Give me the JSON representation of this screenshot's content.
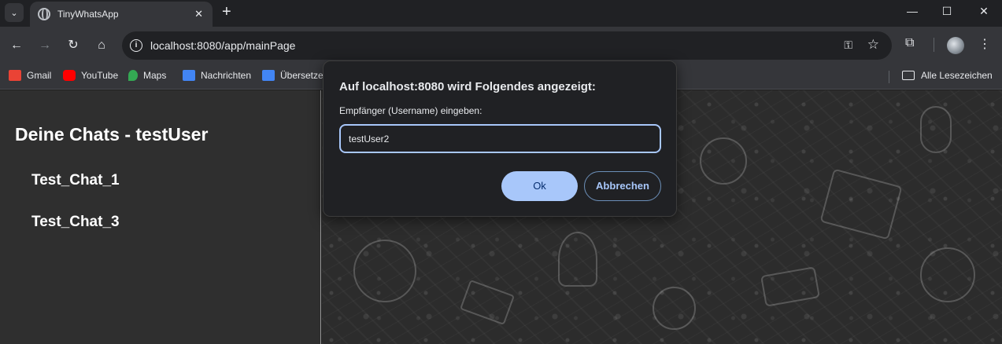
{
  "browser": {
    "tab_title": "TinyWhatsApp",
    "url": "localhost:8080/app/mainPage",
    "bookmarks": [
      {
        "label": "Gmail",
        "icon": "gmail-icon",
        "color": "#ea4335"
      },
      {
        "label": "YouTube",
        "icon": "youtube-icon",
        "color": "#ff0000"
      },
      {
        "label": "Maps",
        "icon": "maps-icon",
        "color": "#34a853"
      },
      {
        "label": "Nachrichten",
        "icon": "news-icon",
        "color": "#4285f4"
      },
      {
        "label": "Übersetze",
        "icon": "translate-icon",
        "color": "#4285f4"
      }
    ],
    "all_bookmarks_label": "Alle Lesezeichen"
  },
  "sidebar": {
    "title": "Deine Chats - testUser",
    "chats": [
      {
        "label": "Test_Chat_1"
      },
      {
        "label": "Test_Chat_3"
      }
    ]
  },
  "dialog": {
    "title": "Auf localhost:8080 wird Folgendes angezeigt:",
    "message": "Empfänger (Username) eingeben:",
    "input_value": "testUser2",
    "ok_label": "Ok",
    "cancel_label": "Abbrechen",
    "accent": "#a8c7fa"
  }
}
